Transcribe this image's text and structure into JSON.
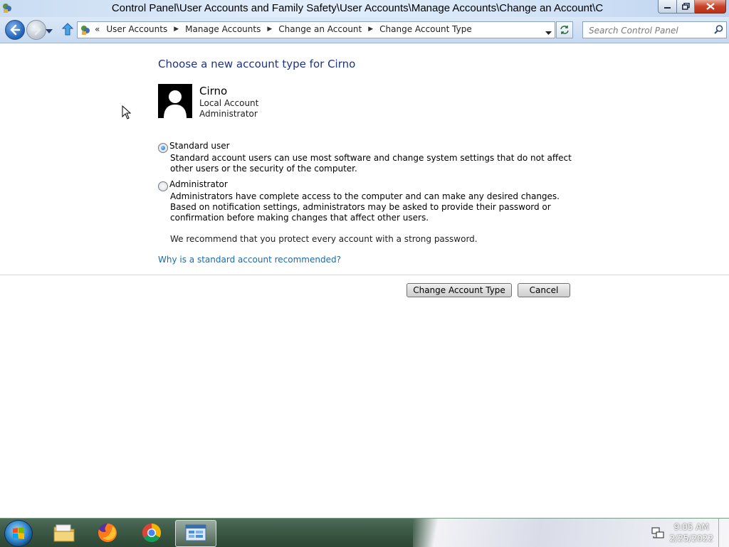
{
  "window": {
    "title": "Control Panel\\User Accounts and Family Safety\\User Accounts\\Manage Accounts\\Change an Account\\C"
  },
  "address_bar": {
    "lead": "«",
    "crumbs": [
      "User Accounts",
      "Manage Accounts",
      "Change an Account",
      "Change Account Type"
    ]
  },
  "search": {
    "placeholder": "Search Control Panel"
  },
  "page": {
    "heading": "Choose a new account type for Cirno",
    "user": {
      "name": "Cirno",
      "type": "Local Account",
      "role": "Administrator"
    },
    "options": [
      {
        "label": "Standard user",
        "selected": true,
        "description": "Standard account users can use most software and change system settings that do not affect other users or the security of the computer."
      },
      {
        "label": "Administrator",
        "selected": false,
        "description": "Administrators have complete access to the computer and can make any desired changes. Based on notification settings, administrators may be asked to provide their password or confirmation before making changes that affect other users."
      }
    ],
    "recommendation": "We recommend that you protect every account with a strong password.",
    "help_link": "Why is a standard account recommended?",
    "buttons": {
      "change": "Change Account Type",
      "cancel": "Cancel"
    }
  },
  "taskbar": {
    "apps": [
      "windows-explorer",
      "firefox",
      "chrome",
      "control-panel"
    ],
    "clock": {
      "time": "9:05 AM",
      "date": "2/25/2022"
    }
  },
  "colors": {
    "heading": "#1e3287",
    "link": "#1a6aa8"
  }
}
